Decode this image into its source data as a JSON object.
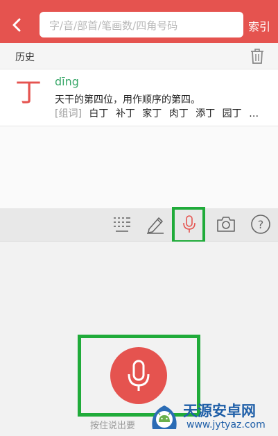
{
  "header": {
    "search_placeholder": "字/音/部首/笔画数/四角号码",
    "index_label": "索引"
  },
  "history": {
    "title": "历史",
    "entries": [
      {
        "character": "丁",
        "pinyin": "dīng",
        "definition": "天干的第四位，用作顺序的第四。",
        "words_tag": "[组词]",
        "words": [
          "白丁",
          "补丁",
          "家丁",
          "肉丁",
          "添丁",
          "园丁",
          "…"
        ]
      }
    ]
  },
  "voice": {
    "hint": "按住说出要"
  },
  "watermark": {
    "title": "天源安卓网",
    "url": "www.jytyaz.com"
  },
  "colors": {
    "brand_red": "#e5534f",
    "highlight_green": "#20ab3a",
    "pinyin_green": "#3aa86a"
  },
  "icons": [
    "back-arrow-icon",
    "trash-icon",
    "list-keyboard-icon",
    "pencil-icon",
    "microphone-icon",
    "camera-icon",
    "question-icon"
  ]
}
